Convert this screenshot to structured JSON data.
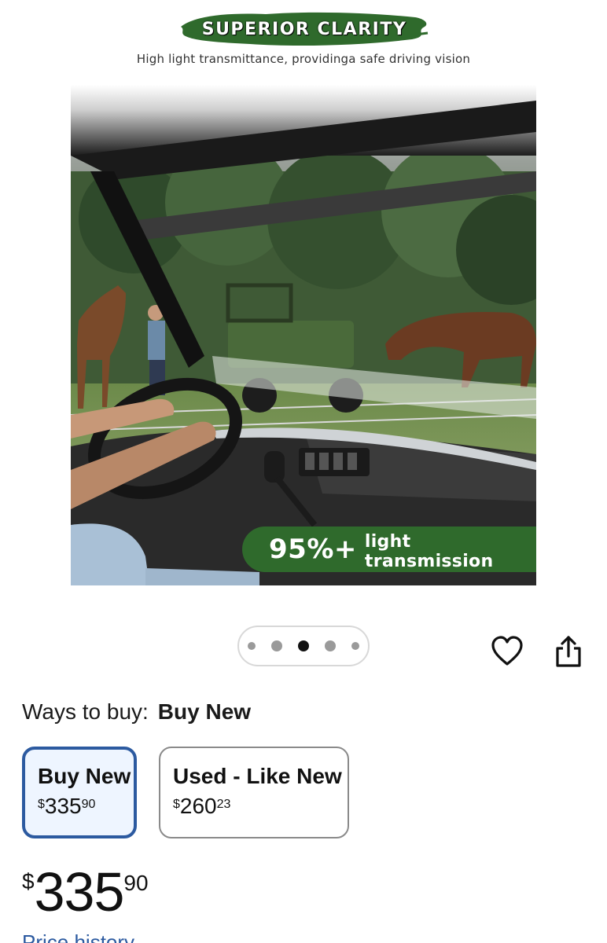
{
  "product_image": {
    "banner_title": "SUPERIOR CLARITY",
    "subheading": "High light transmittance, providinga safe driving vision",
    "badge_big": "95%+",
    "badge_small": "light transmission",
    "colors": {
      "banner_green": "#2f6a2c",
      "badge_green": "#2f6a2c"
    }
  },
  "carousel": {
    "active_index": 2,
    "dot_count": 5
  },
  "actions": {
    "favorite_icon": "heart-outline-icon",
    "share_icon": "share-icon"
  },
  "ways_to_buy": {
    "label": "Ways to buy:",
    "selected": "Buy New",
    "options": [
      {
        "name": "Buy New",
        "currency": "$",
        "dollars": "335",
        "cents": "90",
        "selected": true
      },
      {
        "name": "Used - Like New",
        "currency": "$",
        "dollars": "260",
        "cents": "23",
        "selected": false
      }
    ],
    "colors": {
      "selected_border": "#2c5aa0",
      "selected_bg": "#eef5ff"
    }
  },
  "price": {
    "currency": "$",
    "dollars": "335",
    "cents": "90",
    "history_link": "Price history"
  }
}
